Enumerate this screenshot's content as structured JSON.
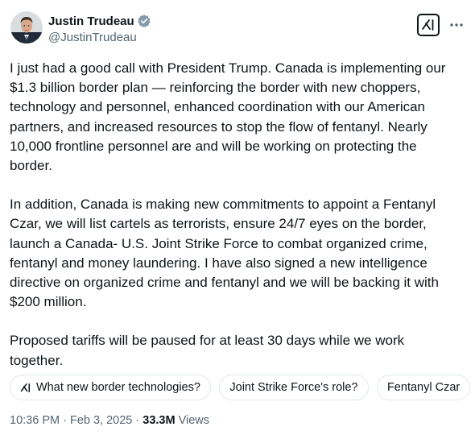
{
  "author": {
    "display_name": "Justin Trudeau",
    "handle": "@JustinTrudeau",
    "verified": true,
    "verified_badge_color": "#829aab",
    "avatar_icon": "profile-photo"
  },
  "header_actions": {
    "grok_icon": "grok-icon",
    "more_icon": "more-icon"
  },
  "tweet": {
    "paragraph_1": "I just had a good call with President Trump. Canada is implementing our\n$1.3 billion border plan — reinforcing the border with new choppers,\ntechnology and personnel, enhanced coordination with our American\npartners, and increased resources to stop the flow of fentanyl. Nearly\n10,000 frontline personnel are and will be working on protecting the\nborder.",
    "paragraph_2": "In addition, Canada is making new commitments to appoint a Fentanyl\nCzar, we will list cartels as terrorists, ensure 24/7 eyes on the border,\nlaunch a Canada- U.S. Joint Strike Force to combat organized crime,\nfentanyl and money laundering. I have also signed a new intelligence\ndirective on organized crime and fentanyl and we will be backing it with\n$200 million.",
    "paragraph_3": "Proposed tariffs will be paused for at least 30 days while we work\ntogether."
  },
  "grok_suggestions": [
    {
      "label": "What new border technologies?",
      "icon": "grok-icon"
    },
    {
      "label": "Joint Strike Force's role?"
    },
    {
      "label": "Fentanyl Czar"
    }
  ],
  "meta": {
    "time": "10:36 PM",
    "separator_1": " · ",
    "date": "Feb 3, 2025",
    "separator_2": " · ",
    "views_count": "33.3M",
    "views_label": " Views"
  },
  "colors": {
    "text_primary": "#0f1419",
    "text_secondary": "#536471",
    "border": "#e1e8ed"
  }
}
